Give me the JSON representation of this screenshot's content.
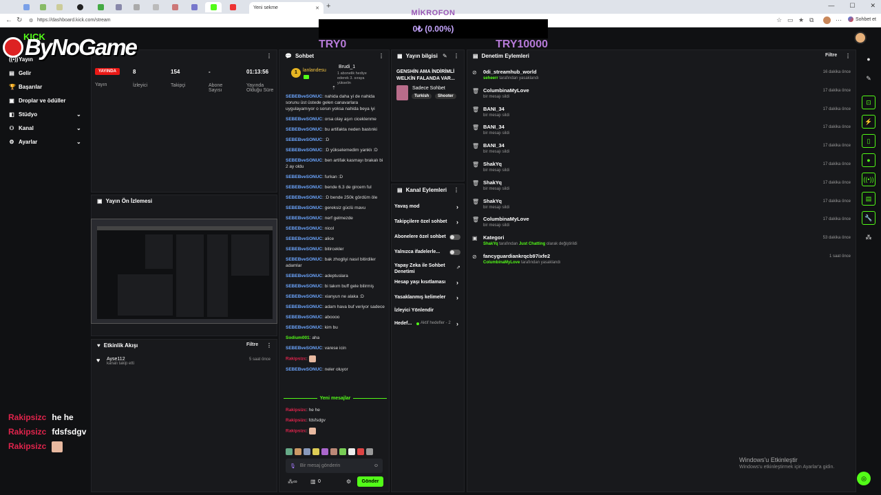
{
  "browser": {
    "active_tab_title": "Yeni sekme",
    "url": "https://dashboard.kick.com/stream",
    "chat_button": "Sohbet et"
  },
  "overlay": {
    "mic_title": "MİKROFON",
    "mic_amount": "0₺ (0.00%)",
    "mic_min": "TRY0",
    "mic_max": "TRY10000",
    "logo_text": "ByNoGame",
    "logo_small": "KICK",
    "chat": [
      {
        "user": "Rakipsizc",
        "msg": "he he"
      },
      {
        "user": "Rakipsizc",
        "msg": "fdsfsdgv"
      },
      {
        "user": "Rakipsizc",
        "msg": ""
      }
    ]
  },
  "sidebar": {
    "items": [
      {
        "label": "Yayın",
        "icon": "broadcast-icon"
      },
      {
        "label": "Gelir",
        "icon": "money-icon"
      },
      {
        "label": "Başarılar",
        "icon": "trophy-icon"
      },
      {
        "label": "Droplar ve ödüller",
        "icon": "gift-icon"
      },
      {
        "label": "Stüdyo",
        "icon": "studio-icon"
      },
      {
        "label": "Kanal",
        "icon": "channel-icon"
      },
      {
        "label": "Ayarlar",
        "icon": "gear-icon"
      }
    ]
  },
  "stats": {
    "live_badge": "YAYINDA",
    "live_label": "Yayın",
    "viewers_value": "8",
    "viewers_label": "İzleyici",
    "followers_value": "154",
    "followers_label": "Takipçi",
    "subs_value": "-",
    "subs_label": "Abone Sayısı",
    "duration_value": "01:13:56",
    "duration_label": "Yayında Olduğu Süre"
  },
  "preview": {
    "title": "Yayın Ön İzlemesi"
  },
  "activity": {
    "title": "Etkinlik Akışı",
    "filter": "Filtre",
    "item_user": "Ayse112",
    "item_desc": "kanalı takip etti",
    "item_time": "5 saat önce"
  },
  "chat": {
    "title": "Sohbet",
    "pinned_user": "lanlandesu",
    "pinned_gift_user": "Brudi_1",
    "pinned_gift_desc": "1 abonelik hediye ederek 3. sıraya yükselin",
    "messages": [
      {
        "user": "SEBEBveSONUC",
        "text": "nahida daha yi de nahida sorunu üst üstede gelen canavarlara uygulayamıyor o sorun yoksa nahida beya iyi",
        "color": "b"
      },
      {
        "user": "SEBEBveSONUC",
        "text": "orsa olay aşırı ciceklenme",
        "color": "b"
      },
      {
        "user": "SEBEBveSONUC",
        "text": "bu artifakta neden bastınki",
        "color": "b"
      },
      {
        "user": "SEBEBveSONUC",
        "text": ":D",
        "color": "b"
      },
      {
        "user": "SEBEBveSONUC",
        "text": ":D yükselemedim yanklı :D",
        "color": "b"
      },
      {
        "user": "SEBEBveSONUC",
        "text": "ben artifak kasmayı brakalı bi 2 ay oldu",
        "color": "b"
      },
      {
        "user": "SEBEBveSONUC",
        "text": "furkan :D",
        "color": "b"
      },
      {
        "user": "SEBEBveSONUC",
        "text": "bende 6.3 de gircem ful",
        "color": "b"
      },
      {
        "user": "SEBEBveSONUC",
        "text": ":D bende 250k gördüm öle",
        "color": "b"
      },
      {
        "user": "SEBEBveSONUC",
        "text": "gereksiz güclü mavu",
        "color": "b"
      },
      {
        "user": "SEBEBveSONUC",
        "text": "nerf gelmezde",
        "color": "b"
      },
      {
        "user": "SEBEBveSONUC",
        "text": "nicol",
        "color": "b"
      },
      {
        "user": "SEBEBveSONUC",
        "text": "alice",
        "color": "b"
      },
      {
        "user": "SEBEBveSONUC",
        "text": "bitircekler",
        "color": "b"
      },
      {
        "user": "SEBEBveSONUC",
        "text": "bak zhogliyi nasıl bitirdiler adamlar",
        "color": "b"
      },
      {
        "user": "SEBEBveSONUC",
        "text": "adeptuslara",
        "color": "b"
      },
      {
        "user": "SEBEBveSONUC",
        "text": "bi takım buff gele bilirmiş",
        "color": "b"
      },
      {
        "user": "SEBEBveSONUC",
        "text": "xianyun ne alaka :D",
        "color": "b"
      },
      {
        "user": "SEBEBveSONUC",
        "text": "adam hava buf veriyor sadece",
        "color": "b"
      },
      {
        "user": "SEBEBveSONUC",
        "text": "aboooo",
        "color": "b"
      },
      {
        "user": "SEBEBveSONUC",
        "text": "kim bu",
        "color": "b"
      },
      {
        "user": "Sodium001",
        "text": "aha",
        "color": "g"
      },
      {
        "user": "SEBEBveSONUC",
        "text": "varese icin",
        "color": "b"
      },
      {
        "user": "Rakipsizc",
        "text": "",
        "color": "r"
      },
      {
        "user": "SEBEBveSONUC",
        "text": "neler oluyor",
        "color": "b"
      }
    ],
    "new_messages_label": "Yeni mesajlar",
    "new_messages": [
      {
        "user": "Rakipsizc",
        "text": "he he"
      },
      {
        "user": "Rakipsizc",
        "text": "fdsfsdgv"
      },
      {
        "user": "Rakipsizc",
        "text": ""
      }
    ],
    "input_placeholder": "Bir mesaj gönderin",
    "points": "0",
    "send_label": "Gönder"
  },
  "stream_info": {
    "title": "Yayın bilgisi",
    "stream_title": "GENSHİN AMA İNDİRİMLİ WELKİN FALANDA VAR...",
    "category": "Sadece Sohbet",
    "tags": [
      "Turkish",
      "Shooter"
    ]
  },
  "channel_actions": {
    "title": "Kanal Eylemleri",
    "items": [
      {
        "label": "Yavaş mod",
        "type": "arrow"
      },
      {
        "label": "Takipçilere özel sohbet",
        "type": "arrow"
      },
      {
        "label": "Abonelere özel sohbet",
        "type": "toggle"
      },
      {
        "label": "Yalnızca ifadelerle...",
        "type": "toggle"
      },
      {
        "label": "Yapay Zeka ile Sohbet Denetimi",
        "type": "ext"
      },
      {
        "label": "Hesap yaşı kısıtlaması",
        "type": "arrow"
      },
      {
        "label": "Yasaklanmış kelimeler",
        "type": "arrow"
      },
      {
        "label": "İzleyici Yönlendir",
        "type": "none"
      },
      {
        "label": "Hedef...",
        "type": "arrow",
        "extra": "Aktif hedefler - 2"
      }
    ]
  },
  "mod_actions": {
    "title": "Denetim Eylemleri",
    "filter": "Filtre",
    "items": [
      {
        "icon": "ban-icon",
        "name": "0di_streamhub_world",
        "sub_user": "seheerr",
        "sub": "tarafından yasaklandı",
        "time": "16 dakika önce"
      },
      {
        "icon": "trash-icon",
        "name": "ColumbinaMyLove",
        "sub_user": "",
        "sub": "bir mesajı sildi",
        "time": "17 dakika önce"
      },
      {
        "icon": "trash-icon",
        "name": "BANI_34",
        "sub_user": "",
        "sub": "bir mesajı sildi",
        "time": "17 dakika önce"
      },
      {
        "icon": "trash-icon",
        "name": "BANI_34",
        "sub_user": "",
        "sub": "bir mesajı sildi",
        "time": "17 dakika önce"
      },
      {
        "icon": "trash-icon",
        "name": "BANI_34",
        "sub_user": "",
        "sub": "bir mesajı sildi",
        "time": "17 dakika önce"
      },
      {
        "icon": "trash-icon",
        "name": "ShakYq",
        "sub_user": "",
        "sub": "bir mesajı sildi",
        "time": "17 dakika önce"
      },
      {
        "icon": "trash-icon",
        "name": "ShakYq",
        "sub_user": "",
        "sub": "bir mesajı sildi",
        "time": "17 dakika önce"
      },
      {
        "icon": "trash-icon",
        "name": "ShakYq",
        "sub_user": "",
        "sub": "bir mesajı sildi",
        "time": "17 dakika önce"
      },
      {
        "icon": "trash-icon",
        "name": "ColumbinaMyLove",
        "sub_user": "",
        "sub": "bir mesajı sildi",
        "time": "17 dakika önce"
      },
      {
        "icon": "category-icon",
        "name": "Kategori",
        "sub_user": "ShakYq",
        "sub": "tarafından",
        "sub_extra": "Just Chatting",
        "sub_tail": "olarak değiştirildi",
        "time": "53 dakika önce"
      },
      {
        "icon": "ban-icon",
        "name": "fancyguardiankrqcb97ixfe2",
        "sub_user": "ColumbinaMyLove",
        "sub": "tarafından yasaklandı",
        "time": "1 saat önce"
      }
    ]
  },
  "windows": {
    "activate_title": "Windows'u Etkinleştir",
    "activate_sub": "Windows'u etkinleştirmek için Ayarlar'a gidin."
  },
  "colors": {
    "accent": "#53fc18",
    "live": "#e91916",
    "chat_user": "#6ca6ff",
    "overlay_purple": "#b67ad8"
  }
}
